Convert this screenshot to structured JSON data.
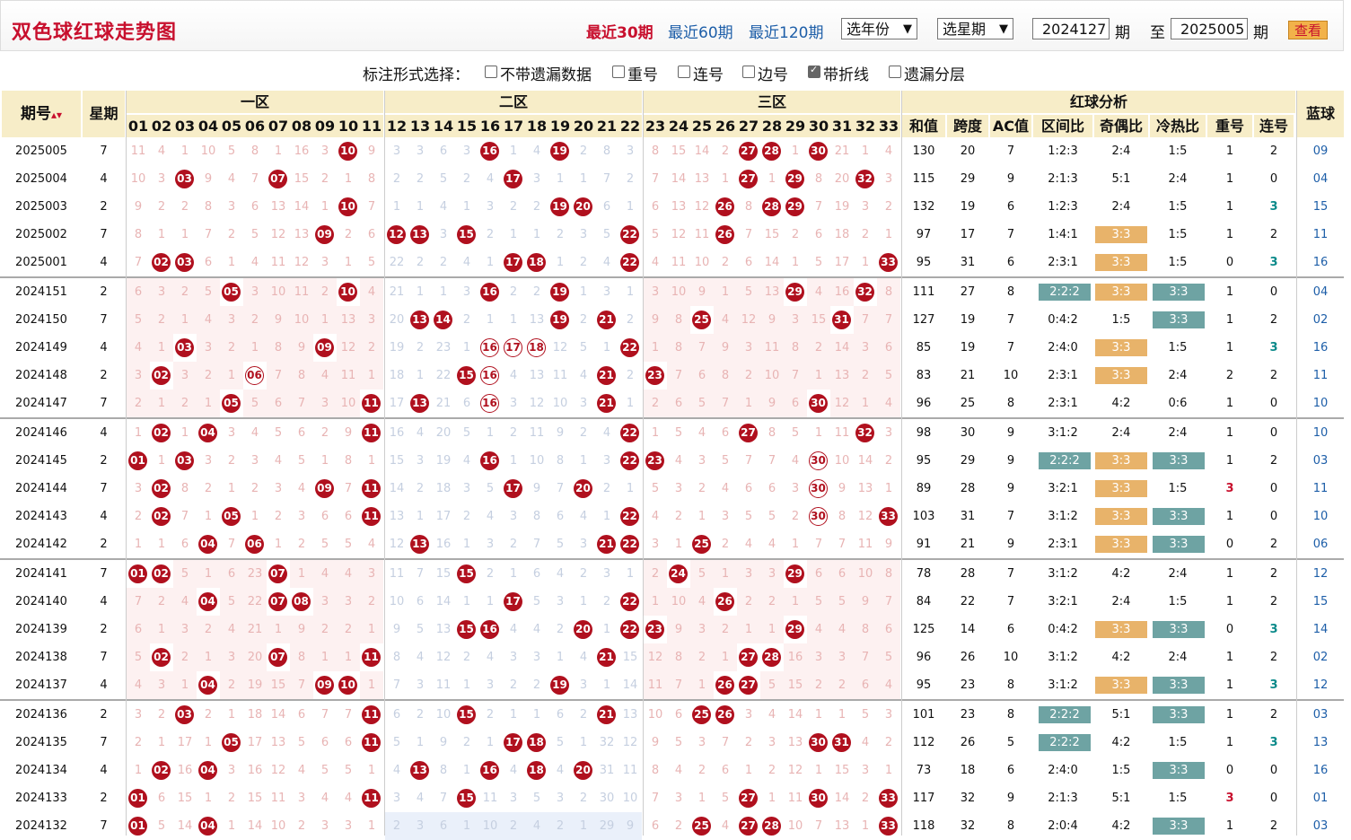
{
  "header": {
    "title": "双色球红球走势图",
    "links": [
      "最近30期",
      "最近60期",
      "最近120期"
    ],
    "year_select": "选年份",
    "issue_select": "选星期",
    "from_issue": "2024127",
    "issue_label": "期",
    "to_label": "至",
    "to_issue": "2025005",
    "issue_label2": "期",
    "view_button": "查看"
  },
  "options": {
    "title": "标注形式选择：",
    "items": [
      {
        "label": "不带遗漏数据",
        "checked": false
      },
      {
        "label": "重号",
        "checked": false
      },
      {
        "label": "连号",
        "checked": false
      },
      {
        "label": "边号",
        "checked": false
      },
      {
        "label": "带折线",
        "checked": true
      },
      {
        "label": "遗漏分层",
        "checked": false
      }
    ]
  },
  "table_header": {
    "issue": "期号",
    "sort_icon": "sort-icon",
    "week": "星期",
    "zones": [
      "一区",
      "二区",
      "三区"
    ],
    "analysis": "红球分析",
    "analysis_cols": [
      "和值",
      "跨度",
      "AC值",
      "区间比",
      "奇偶比",
      "冷热比",
      "重号",
      "连号"
    ],
    "blue": "蓝球",
    "numbers": [
      "01",
      "02",
      "03",
      "04",
      "05",
      "06",
      "07",
      "08",
      "09",
      "10",
      "11",
      "12",
      "13",
      "14",
      "15",
      "16",
      "17",
      "18",
      "19",
      "20",
      "21",
      "22",
      "23",
      "24",
      "25",
      "26",
      "27",
      "28",
      "29",
      "30",
      "31",
      "32",
      "33"
    ]
  },
  "colors": {
    "ball": "#b0101e",
    "accent": "#c8102e",
    "link": "#1d5ea8",
    "header_bg": "#f7edc8",
    "tag_orange": "#e8b36a",
    "tag_teal": "#6ea3a3"
  },
  "rows": [
    {
      "issue": "2025005",
      "week": "7",
      "cells": [
        11,
        4,
        1,
        10,
        5,
        8,
        1,
        16,
        3,
        "B",
        9,
        3,
        3,
        6,
        3,
        "B",
        1,
        4,
        "B",
        2,
        8,
        3,
        8,
        15,
        14,
        2,
        "B",
        "B",
        1,
        "B",
        21,
        1,
        4
      ],
      "sum": "130",
      "span": "20",
      "ac": "7",
      "zone": "1:2:3",
      "oe": "2:4",
      "oe_tag": "",
      "ch": "1:5",
      "ch_tag": "",
      "zone_tag": "",
      "rep": "1",
      "cons": "2",
      "blue": "09"
    },
    {
      "issue": "2025004",
      "week": "4",
      "cells": [
        10,
        3,
        "B",
        9,
        4,
        7,
        "B",
        15,
        2,
        1,
        8,
        2,
        2,
        5,
        2,
        4,
        "B",
        3,
        1,
        1,
        7,
        2,
        7,
        14,
        13,
        1,
        "B",
        1,
        "B",
        8,
        20,
        "B",
        3
      ],
      "sum": "115",
      "span": "29",
      "ac": "9",
      "zone": "2:1:3",
      "oe": "5:1",
      "oe_tag": "",
      "ch": "2:4",
      "ch_tag": "",
      "zone_tag": "",
      "rep": "1",
      "cons": "0",
      "blue": "04"
    },
    {
      "issue": "2025003",
      "week": "2",
      "cells": [
        9,
        2,
        2,
        8,
        3,
        6,
        13,
        14,
        1,
        "B",
        7,
        1,
        1,
        4,
        1,
        3,
        2,
        2,
        "B",
        "B",
        6,
        1,
        6,
        13,
        12,
        "B",
        8,
        "B",
        "B",
        7,
        19,
        3,
        2
      ],
      "sum": "132",
      "span": "19",
      "ac": "6",
      "zone": "1:2:3",
      "oe": "2:4",
      "oe_tag": "",
      "ch": "1:5",
      "ch_tag": "",
      "zone_tag": "",
      "rep": "1",
      "cons": "3",
      "blue": "15"
    },
    {
      "issue": "2025002",
      "week": "7",
      "cells": [
        8,
        1,
        1,
        7,
        2,
        5,
        12,
        13,
        "B",
        2,
        6,
        "B",
        "B",
        3,
        "B",
        2,
        1,
        1,
        2,
        3,
        5,
        "B",
        5,
        12,
        11,
        "B",
        7,
        15,
        2,
        6,
        18,
        2,
        1
      ],
      "sum": "97",
      "span": "17",
      "ac": "7",
      "zone": "1:4:1",
      "oe": "3:3",
      "oe_tag": "or",
      "ch": "1:5",
      "ch_tag": "",
      "zone_tag": "",
      "rep": "1",
      "cons": "2",
      "blue": "11"
    },
    {
      "issue": "2025001",
      "week": "4",
      "cells": [
        7,
        "B",
        "B",
        6,
        1,
        4,
        11,
        12,
        3,
        1,
        5,
        22,
        2,
        2,
        4,
        1,
        "B",
        "B",
        1,
        2,
        4,
        "B",
        4,
        11,
        10,
        2,
        6,
        14,
        1,
        5,
        17,
        1,
        "B"
      ],
      "sum": "95",
      "span": "31",
      "ac": "6",
      "zone": "2:3:1",
      "oe": "3:3",
      "oe_tag": "or",
      "ch": "1:5",
      "ch_tag": "",
      "zone_tag": "",
      "rep": "0",
      "cons": "3",
      "blue": "16"
    },
    {
      "issue": "2024151",
      "week": "2",
      "cells": [
        6,
        3,
        2,
        5,
        "B",
        3,
        10,
        11,
        2,
        "B",
        4,
        21,
        1,
        1,
        3,
        "B",
        2,
        2,
        "B",
        1,
        3,
        1,
        3,
        10,
        9,
        1,
        5,
        13,
        "B",
        4,
        16,
        "B",
        8
      ],
      "sum": "111",
      "span": "27",
      "ac": "8",
      "zone": "2:2:2",
      "oe": "3:3",
      "oe_tag": "or",
      "ch": "3:3",
      "ch_tag": "tl",
      "zone_tag": "tl",
      "rep": "1",
      "cons": "0",
      "blue": "04"
    },
    {
      "issue": "2024150",
      "week": "7",
      "cells": [
        5,
        2,
        1,
        4,
        3,
        2,
        9,
        10,
        1,
        13,
        3,
        20,
        "B",
        "B",
        2,
        1,
        1,
        13,
        "B",
        2,
        "B",
        2,
        9,
        8,
        "B",
        4,
        12,
        9,
        3,
        15,
        "B",
        7,
        7
      ],
      "sum": "127",
      "span": "19",
      "ac": "7",
      "zone": "0:4:2",
      "oe": "1:5",
      "oe_tag": "",
      "ch": "3:3",
      "ch_tag": "tl",
      "zone_tag": "",
      "rep": "1",
      "cons": "2",
      "blue": "02"
    },
    {
      "issue": "2024149",
      "week": "4",
      "cells": [
        4,
        1,
        "B",
        3,
        2,
        1,
        8,
        9,
        "B",
        12,
        2,
        19,
        2,
        23,
        1,
        "R",
        "R",
        "R",
        12,
        5,
        1,
        "B",
        1,
        8,
        7,
        9,
        3,
        11,
        8,
        2,
        14,
        3,
        6
      ],
      "sum": "85",
      "span": "19",
      "ac": "7",
      "zone": "2:4:0",
      "oe": "3:3",
      "oe_tag": "or",
      "ch": "1:5",
      "ch_tag": "",
      "zone_tag": "",
      "rep": "1",
      "cons": "3",
      "blue": "16"
    },
    {
      "issue": "2024148",
      "week": "2",
      "cells": [
        3,
        "B",
        3,
        2,
        1,
        "R",
        7,
        8,
        4,
        11,
        1,
        18,
        1,
        22,
        "B",
        "R",
        4,
        13,
        11,
        4,
        "B",
        2,
        "B",
        7,
        6,
        8,
        2,
        10,
        7,
        1,
        13,
        2,
        5
      ],
      "sum": "83",
      "span": "21",
      "ac": "10",
      "zone": "2:3:1",
      "oe": "3:3",
      "oe_tag": "or",
      "ch": "2:4",
      "ch_tag": "",
      "zone_tag": "",
      "rep": "2",
      "cons": "2",
      "blue": "11"
    },
    {
      "issue": "2024147",
      "week": "7",
      "cells": [
        2,
        1,
        2,
        1,
        "B",
        5,
        6,
        7,
        3,
        10,
        "B",
        17,
        "B",
        21,
        6,
        "R",
        3,
        12,
        10,
        3,
        "B",
        1,
        2,
        6,
        5,
        7,
        1,
        9,
        6,
        "B",
        12,
        1,
        4
      ],
      "sum": "96",
      "span": "25",
      "ac": "8",
      "zone": "2:3:1",
      "oe": "4:2",
      "oe_tag": "",
      "ch": "0:6",
      "ch_tag": "",
      "zone_tag": "",
      "rep": "1",
      "cons": "0",
      "blue": "10"
    },
    {
      "issue": "2024146",
      "week": "4",
      "cells": [
        1,
        "B",
        1,
        "B",
        3,
        4,
        5,
        6,
        2,
        9,
        "B",
        16,
        4,
        20,
        5,
        1,
        2,
        11,
        9,
        2,
        4,
        "B",
        1,
        5,
        4,
        6,
        "B",
        8,
        5,
        1,
        11,
        "B",
        3
      ],
      "sum": "98",
      "span": "30",
      "ac": "9",
      "zone": "3:1:2",
      "oe": "2:4",
      "oe_tag": "",
      "ch": "2:4",
      "ch_tag": "",
      "zone_tag": "",
      "rep": "1",
      "cons": "0",
      "blue": "10"
    },
    {
      "issue": "2024145",
      "week": "2",
      "cells": [
        "B",
        1,
        "B",
        3,
        2,
        3,
        4,
        5,
        1,
        8,
        1,
        15,
        3,
        19,
        4,
        "B",
        1,
        10,
        8,
        1,
        3,
        "B",
        "B",
        4,
        3,
        5,
        7,
        7,
        4,
        "R",
        10,
        14,
        2
      ],
      "sum": "95",
      "span": "29",
      "ac": "9",
      "zone": "2:2:2",
      "oe": "3:3",
      "oe_tag": "or",
      "ch": "3:3",
      "ch_tag": "tl",
      "zone_tag": "tl",
      "rep": "1",
      "cons": "2",
      "blue": "03"
    },
    {
      "issue": "2024144",
      "week": "7",
      "cells": [
        3,
        "B",
        8,
        2,
        1,
        2,
        3,
        4,
        "B",
        7,
        "B",
        14,
        2,
        18,
        3,
        5,
        "B",
        9,
        7,
        "B",
        2,
        1,
        5,
        3,
        2,
        4,
        6,
        6,
        3,
        "R",
        9,
        13,
        1
      ],
      "sum": "89",
      "span": "28",
      "ac": "9",
      "zone": "3:2:1",
      "oe": "3:3",
      "oe_tag": "or",
      "ch": "1:5",
      "ch_tag": "",
      "zone_tag": "",
      "rep": "3",
      "cons": "0",
      "blue": "11"
    },
    {
      "issue": "2024143",
      "week": "4",
      "cells": [
        2,
        "B",
        7,
        1,
        "B",
        1,
        2,
        3,
        6,
        6,
        "B",
        13,
        1,
        17,
        2,
        4,
        3,
        8,
        6,
        4,
        1,
        "B",
        4,
        2,
        1,
        3,
        5,
        5,
        2,
        "R",
        8,
        12,
        "B"
      ],
      "sum": "103",
      "span": "31",
      "ac": "7",
      "zone": "3:1:2",
      "oe": "3:3",
      "oe_tag": "or",
      "ch": "3:3",
      "ch_tag": "tl",
      "zone_tag": "",
      "rep": "1",
      "cons": "0",
      "blue": "10"
    },
    {
      "issue": "2024142",
      "week": "2",
      "cells": [
        1,
        1,
        6,
        "B",
        7,
        "B",
        1,
        2,
        5,
        5,
        4,
        12,
        "B",
        16,
        1,
        3,
        2,
        7,
        5,
        3,
        "B",
        "B",
        3,
        1,
        "B",
        2,
        4,
        4,
        1,
        7,
        7,
        11,
        9
      ],
      "sum": "91",
      "span": "21",
      "ac": "9",
      "zone": "2:3:1",
      "oe": "3:3",
      "oe_tag": "or",
      "ch": "3:3",
      "ch_tag": "tl",
      "zone_tag": "",
      "rep": "0",
      "cons": "2",
      "blue": "06"
    },
    {
      "issue": "2024141",
      "week": "7",
      "cells": [
        "B",
        "B",
        5,
        1,
        6,
        23,
        "B",
        1,
        4,
        4,
        3,
        11,
        7,
        15,
        "B",
        2,
        1,
        6,
        4,
        2,
        3,
        1,
        2,
        "B",
        5,
        1,
        3,
        3,
        "B",
        6,
        6,
        10,
        8
      ],
      "sum": "78",
      "span": "28",
      "ac": "7",
      "zone": "3:1:2",
      "oe": "4:2",
      "oe_tag": "",
      "ch": "2:4",
      "ch_tag": "",
      "zone_tag": "",
      "rep": "1",
      "cons": "2",
      "blue": "12"
    },
    {
      "issue": "2024140",
      "week": "4",
      "cells": [
        7,
        2,
        4,
        "B",
        5,
        22,
        "B",
        "B",
        3,
        3,
        2,
        10,
        6,
        14,
        1,
        1,
        "B",
        5,
        3,
        1,
        2,
        "B",
        1,
        10,
        4,
        "B",
        2,
        2,
        1,
        5,
        5,
        9,
        7
      ],
      "sum": "84",
      "span": "22",
      "ac": "7",
      "zone": "3:2:1",
      "oe": "2:4",
      "oe_tag": "",
      "ch": "1:5",
      "ch_tag": "",
      "zone_tag": "",
      "rep": "1",
      "cons": "2",
      "blue": "15"
    },
    {
      "issue": "2024139",
      "week": "2",
      "cells": [
        6,
        1,
        3,
        2,
        4,
        21,
        1,
        9,
        2,
        2,
        1,
        9,
        5,
        13,
        "B",
        "B",
        4,
        4,
        2,
        "B",
        1,
        "B",
        "B",
        9,
        3,
        2,
        1,
        1,
        "B",
        4,
        4,
        8,
        6
      ],
      "sum": "125",
      "span": "14",
      "ac": "6",
      "zone": "0:4:2",
      "oe": "3:3",
      "oe_tag": "or",
      "ch": "3:3",
      "ch_tag": "tl",
      "zone_tag": "",
      "rep": "0",
      "cons": "3",
      "blue": "14"
    },
    {
      "issue": "2024138",
      "week": "7",
      "cells": [
        5,
        "B",
        2,
        1,
        3,
        20,
        "B",
        8,
        1,
        1,
        "B",
        8,
        4,
        12,
        2,
        4,
        3,
        3,
        1,
        4,
        "B",
        15,
        12,
        8,
        2,
        1,
        "B",
        "B",
        16,
        3,
        3,
        7,
        5
      ],
      "sum": "96",
      "span": "26",
      "ac": "10",
      "zone": "3:1:2",
      "oe": "4:2",
      "oe_tag": "",
      "ch": "2:4",
      "ch_tag": "",
      "zone_tag": "",
      "rep": "1",
      "cons": "2",
      "blue": "02"
    },
    {
      "issue": "2024137",
      "week": "4",
      "cells": [
        4,
        3,
        1,
        "B",
        2,
        19,
        15,
        7,
        "B",
        "B",
        1,
        7,
        3,
        11,
        1,
        3,
        2,
        2,
        "B",
        3,
        1,
        14,
        11,
        7,
        1,
        "B",
        "B",
        5,
        15,
        2,
        2,
        6,
        4
      ],
      "sum": "95",
      "span": "23",
      "ac": "8",
      "zone": "3:1:2",
      "oe": "3:3",
      "oe_tag": "or",
      "ch": "3:3",
      "ch_tag": "tl",
      "zone_tag": "",
      "rep": "1",
      "cons": "3",
      "blue": "12"
    },
    {
      "issue": "2024136",
      "week": "2",
      "cells": [
        3,
        2,
        "B",
        2,
        1,
        18,
        14,
        6,
        7,
        7,
        "B",
        6,
        2,
        10,
        "B",
        2,
        1,
        1,
        6,
        2,
        "B",
        13,
        10,
        6,
        "B",
        "B",
        3,
        4,
        14,
        1,
        1,
        5,
        3
      ],
      "sum": "101",
      "span": "23",
      "ac": "8",
      "zone": "2:2:2",
      "oe": "5:1",
      "oe_tag": "",
      "ch": "3:3",
      "ch_tag": "tl",
      "zone_tag": "tl",
      "rep": "1",
      "cons": "2",
      "blue": "03"
    },
    {
      "issue": "2024135",
      "week": "7",
      "cells": [
        2,
        1,
        17,
        1,
        "B",
        17,
        13,
        5,
        6,
        6,
        "B",
        5,
        1,
        9,
        2,
        1,
        "B",
        "B",
        5,
        1,
        32,
        12,
        9,
        5,
        3,
        7,
        2,
        3,
        13,
        "B",
        "B",
        4,
        2
      ],
      "sum": "112",
      "span": "26",
      "ac": "5",
      "zone": "2:2:2",
      "oe": "4:2",
      "oe_tag": "",
      "ch": "1:5",
      "ch_tag": "",
      "zone_tag": "tl",
      "rep": "1",
      "cons": "3",
      "blue": "13"
    },
    {
      "issue": "2024134",
      "week": "4",
      "cells": [
        1,
        "B",
        16,
        "B",
        3,
        16,
        12,
        4,
        5,
        5,
        1,
        4,
        "B",
        8,
        1,
        "B",
        4,
        "B",
        4,
        "B",
        31,
        11,
        8,
        4,
        2,
        6,
        1,
        2,
        12,
        1,
        15,
        3,
        1
      ],
      "sum": "73",
      "span": "18",
      "ac": "6",
      "zone": "2:4:0",
      "oe": "1:5",
      "oe_tag": "",
      "ch": "3:3",
      "ch_tag": "tl",
      "zone_tag": "",
      "rep": "0",
      "cons": "0",
      "blue": "16"
    },
    {
      "issue": "2024133",
      "week": "2",
      "cells": [
        "B",
        6,
        15,
        1,
        2,
        15,
        11,
        3,
        4,
        4,
        "B",
        3,
        4,
        7,
        "B",
        11,
        3,
        5,
        3,
        2,
        30,
        10,
        7,
        3,
        1,
        5,
        "B",
        1,
        11,
        "B",
        14,
        2,
        "B"
      ],
      "sum": "117",
      "span": "32",
      "ac": "9",
      "zone": "2:1:3",
      "oe": "5:1",
      "oe_tag": "",
      "ch": "1:5",
      "ch_tag": "",
      "zone_tag": "",
      "rep": "3",
      "cons": "0",
      "blue": "01"
    },
    {
      "issue": "2024132",
      "week": "7",
      "cells": [
        "B",
        5,
        14,
        "B",
        1,
        14,
        10,
        2,
        3,
        3,
        1,
        2,
        3,
        6,
        1,
        10,
        2,
        4,
        2,
        1,
        29,
        9,
        6,
        2,
        "B",
        4,
        "B",
        "B",
        10,
        7,
        13,
        1,
        "B"
      ],
      "sum": "118",
      "span": "32",
      "ac": "8",
      "zone": "2:0:4",
      "oe": "4:2",
      "oe_tag": "",
      "ch": "3:3",
      "ch_tag": "tl",
      "zone_tag": "",
      "rep": "1",
      "cons": "2",
      "blue": "03"
    }
  ]
}
